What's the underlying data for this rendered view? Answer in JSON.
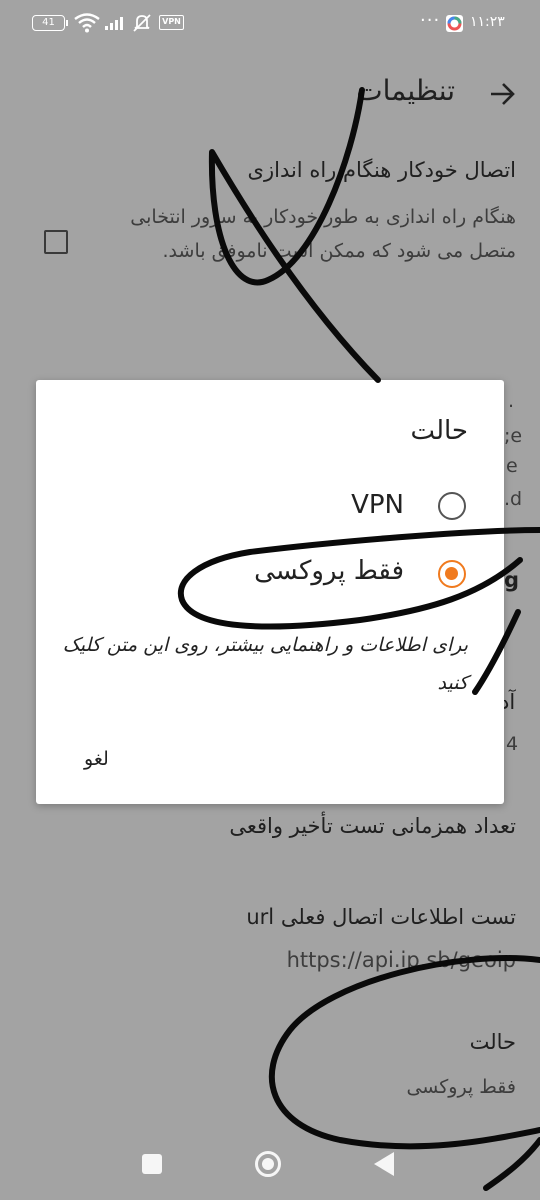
{
  "status_bar": {
    "battery": "41",
    "vpn_badge": "VPN",
    "dots": "···",
    "time": "١١:٢٣"
  },
  "header": {
    "title": "تنظیمات"
  },
  "prefs": {
    "auto_connect_title": "اتصال خودکار هنگام راه اندازی",
    "auto_connect_summary": "هنگام راه اندازی به طور خودکار به سرور انتخابی متصل می شود که ممکن است ناموفق باشد.",
    "partial_right_1": "آد",
    "partial_right_2": "4",
    "partial_edge_1": ".",
    "partial_edge_2": "e;",
    "partial_edge_3": "e",
    "partial_edge_4": "d.",
    "partial_edge_5": "g",
    "concurrency_title": "تعداد همزمانی تست تأخیر واقعی",
    "url_test_title": "تست اطلاعات اتصال فعلی url",
    "url_test_value": "https://api.ip.sb/geoip",
    "mode_title": "حالت",
    "mode_value": "فقط پروکسی"
  },
  "dialog": {
    "title": "حالت",
    "options": [
      {
        "label": "VPN",
        "selected": false
      },
      {
        "label": "فقط پروکسی",
        "selected": true
      }
    ],
    "hint": "برای اطلاعات و راهنمایی بیشتر، روی این متن کلیک کنید",
    "cancel": "لغو"
  },
  "colors": {
    "accent": "#f07a1e",
    "scrim": "#a3a3a3",
    "dialog_bg": "#ffffff"
  }
}
